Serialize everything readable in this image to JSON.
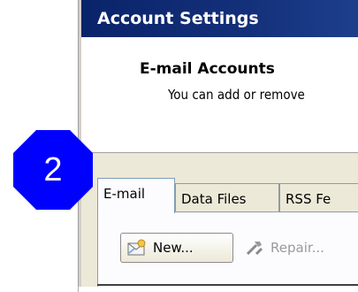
{
  "dialog": {
    "title": "Account Settings",
    "heading": "E-mail Accounts",
    "subtext": "You can add or remove"
  },
  "tabs": [
    {
      "label": "E-mail",
      "active": true
    },
    {
      "label": "Data Files",
      "active": false
    },
    {
      "label": "RSS Fe",
      "active": false
    }
  ],
  "toolbar": {
    "new_label": "New...",
    "repair_label": "Repair..."
  },
  "badge": {
    "number": "2",
    "color": "#0000ff"
  },
  "colors": {
    "titlebar": "#0a246a",
    "dialog_bg": "#ece9d8"
  }
}
